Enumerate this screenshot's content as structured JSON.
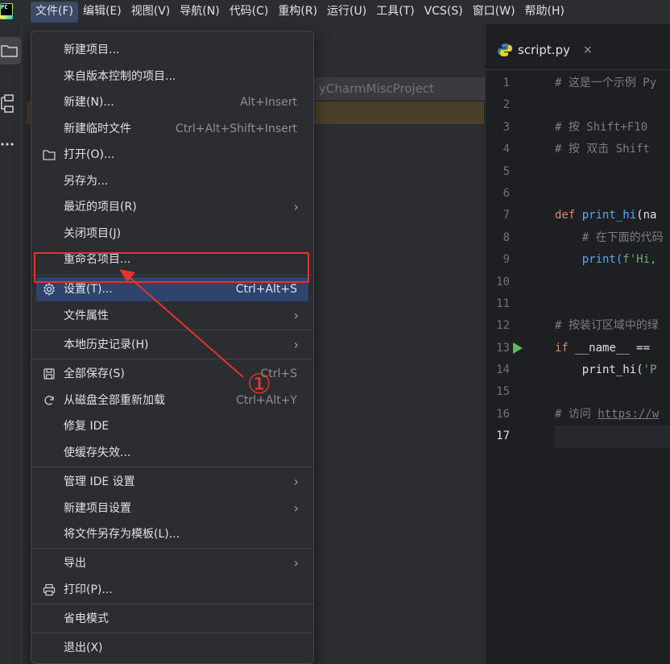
{
  "app": {
    "logo_text": "PC"
  },
  "menubar": {
    "items": [
      {
        "label": "文件(F)",
        "active": true
      },
      {
        "label": "编辑(E)"
      },
      {
        "label": "视图(V)"
      },
      {
        "label": "导航(N)"
      },
      {
        "label": "代码(C)"
      },
      {
        "label": "重构(R)"
      },
      {
        "label": "运行(U)"
      },
      {
        "label": "工具(T)"
      },
      {
        "label": "VCS(S)"
      },
      {
        "label": "窗口(W)"
      },
      {
        "label": "帮助(H)"
      }
    ]
  },
  "project": {
    "path_partial": "yCharmMiscProject"
  },
  "editor": {
    "tab": {
      "label": "script.py",
      "close": "×"
    },
    "lines": [
      {
        "n": "1",
        "text": "# 这是一个示例 Py"
      },
      {
        "n": "2",
        "text": ""
      },
      {
        "n": "3",
        "text": "# 按 Shift+F10"
      },
      {
        "n": "4",
        "text": "# 按 双击 Shift "
      },
      {
        "n": "5",
        "text": ""
      },
      {
        "n": "6",
        "text": ""
      },
      {
        "n": "7",
        "text_kw": "def ",
        "text_fn": "print_hi",
        "text_rest": "(na"
      },
      {
        "n": "8",
        "text": "    # 在下面的代码"
      },
      {
        "n": "9",
        "text_a": "    print(",
        "text_str": "f'Hi,"
      },
      {
        "n": "10",
        "text": ""
      },
      {
        "n": "11",
        "text": ""
      },
      {
        "n": "12",
        "text": "# 按装订区域中的绿"
      },
      {
        "n": "13",
        "text_kw": "if ",
        "text_rest": "__name__ =="
      },
      {
        "n": "14",
        "text_a": "    print_hi(",
        "text_str": "'P"
      },
      {
        "n": "15",
        "text": ""
      },
      {
        "n": "16",
        "text_c": "# 访问 ",
        "text_url": "https://w"
      },
      {
        "n": "17",
        "text": ""
      }
    ]
  },
  "file_menu": {
    "items": [
      {
        "label": "新建项目..."
      },
      {
        "label": "来自版本控制的项目..."
      },
      {
        "label": "新建(N)...",
        "shortcut": "Alt+Insert"
      },
      {
        "label": "新建临时文件",
        "shortcut": "Ctrl+Alt+Shift+Insert"
      },
      {
        "label": "打开(O)...",
        "icon": "folder-icon"
      },
      {
        "label": "另存为..."
      },
      {
        "label": "最近的项目(R)",
        "submenu": true
      },
      {
        "label": "关闭项目(J)"
      },
      {
        "label": "重命名项目..."
      },
      {
        "label": "设置(T)...",
        "shortcut": "Ctrl+Alt+S",
        "icon": "gear-icon",
        "selected": true
      },
      {
        "label": "文件属性",
        "submenu": true
      },
      {
        "label": "本地历史记录(H)",
        "submenu": true
      },
      {
        "label": "全部保存(S)",
        "shortcut": "Ctrl+S",
        "icon": "save-icon"
      },
      {
        "label": "从磁盘全部重新加载",
        "shortcut": "Ctrl+Alt+Y",
        "icon": "reload-icon"
      },
      {
        "label": "修复 IDE"
      },
      {
        "label": "使缓存失效..."
      },
      {
        "label": "管理 IDE 设置",
        "submenu": true
      },
      {
        "label": "新建项目设置",
        "submenu": true
      },
      {
        "label": "将文件另存为模板(L)..."
      },
      {
        "label": "导出",
        "submenu": true
      },
      {
        "label": "打印(P)...",
        "icon": "print-icon"
      },
      {
        "label": "省电模式"
      },
      {
        "label": "退出(X)"
      }
    ],
    "arrow_glyph": "›"
  },
  "annotation": {
    "label": "①",
    "color": "#e8322b"
  }
}
